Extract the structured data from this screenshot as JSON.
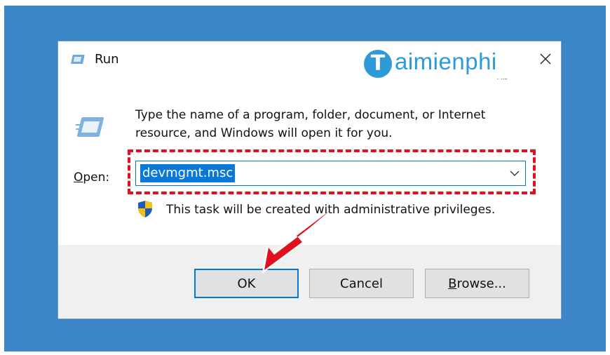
{
  "dialog": {
    "title": "Run",
    "description": "Type the name of a program, folder, document, or Internet resource, and Windows will open it for you.",
    "open_label_u": "O",
    "open_label_rest": "pen:",
    "input_value": "devmgmt.msc",
    "admin_note": "This task will be created with administrative privileges.",
    "buttons": {
      "ok": "OK",
      "cancel": "Cancel",
      "browse_u": "B",
      "browse_rest": "rowse..."
    }
  },
  "watermark": {
    "letter": "T",
    "text": "aimienphi",
    "sub": ".vn"
  },
  "colors": {
    "desktop": "#3d87c9",
    "highlight": "#e0101e",
    "selection": "#0a78d7",
    "arrow": "#e0101e"
  },
  "icons": [
    "run-window-icon",
    "close-icon",
    "chevron-down-icon",
    "uac-shield-icon",
    "pointer-arrow-icon"
  ]
}
